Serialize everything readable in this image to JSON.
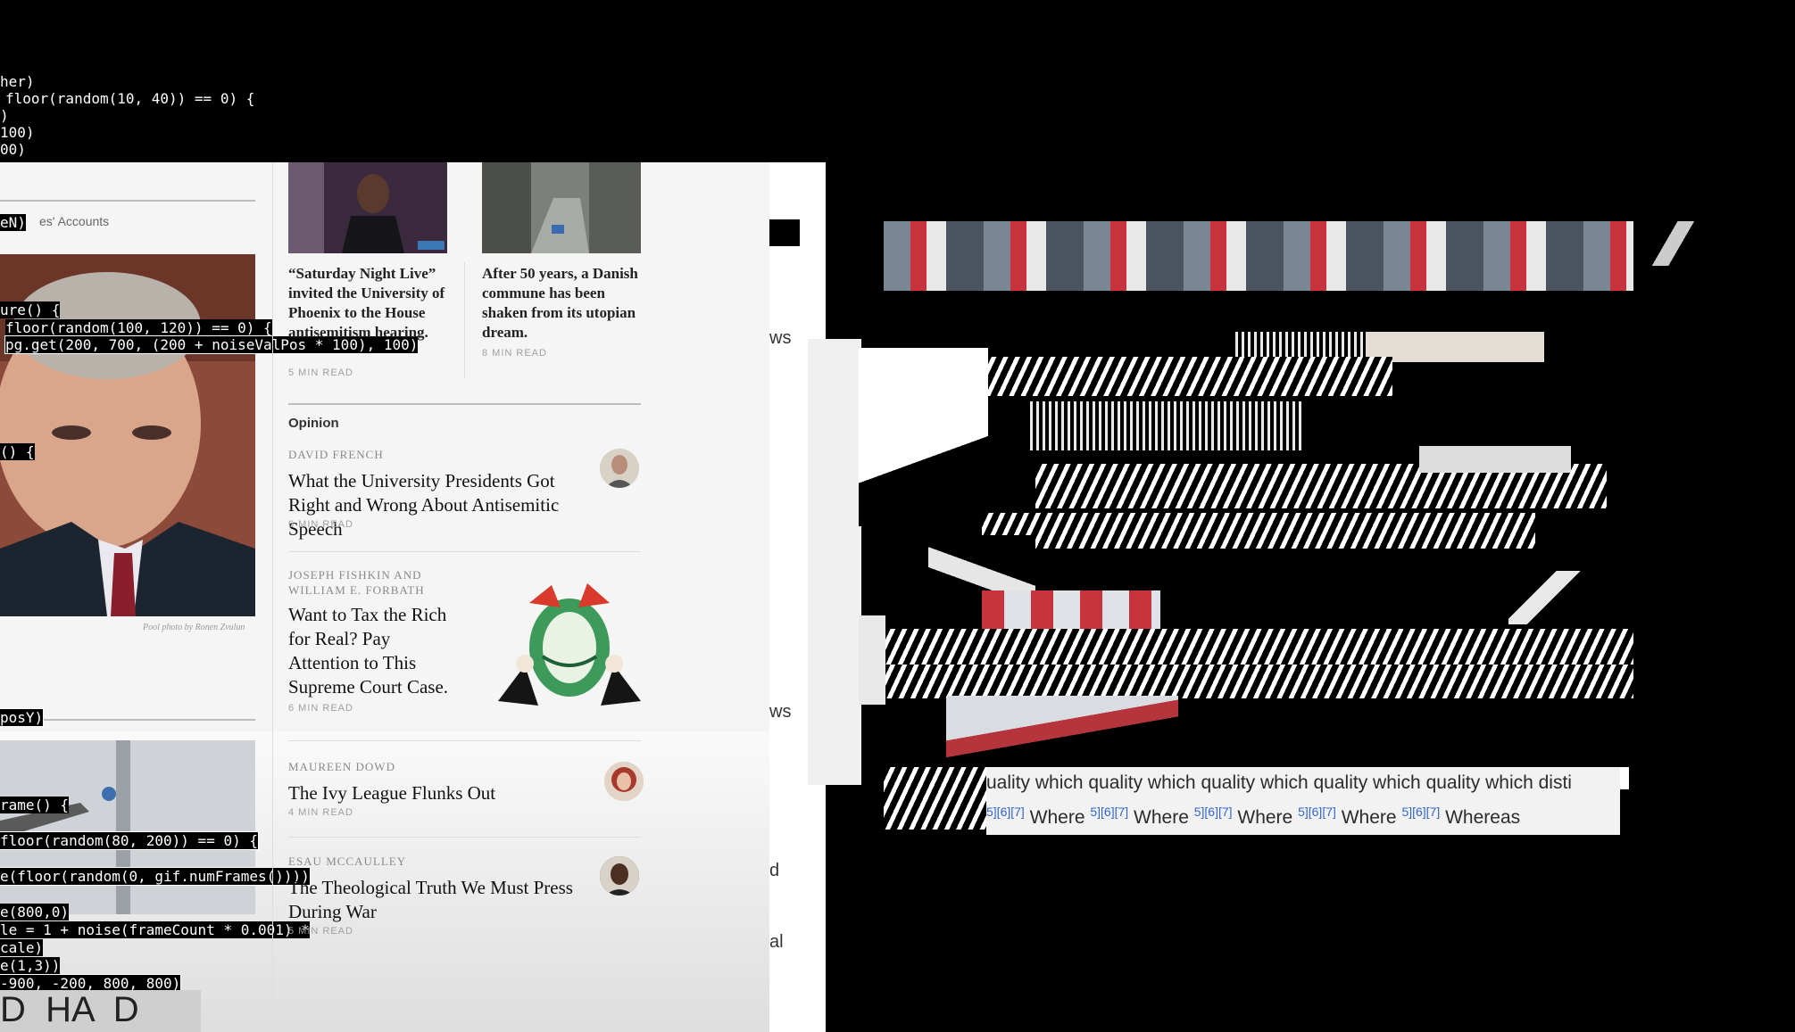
{
  "code_lines": [
    "her)",
    "floor(random(10, 40)) == 0) {",
    ")",
    "100)",
    "00)",
    "ure() {",
    "floor(random(100, 120)) == 0) {",
    "pg.get(200, 700, (200 + noiseValPos * 100), 100)",
    "() {",
    "posY)",
    "rame() {",
    "floor(random(80, 200)) == 0) {",
    "e(floor(random(0, gif.numFrames())))",
    "e(800,0)",
    "le = 1 + noise(frameCount * 0.001) *",
    "cale)",
    "e(1,3))",
    "-900, -200, 800, 800)"
  ],
  "left_column": {
    "accounts_label": "es' Accounts",
    "photo_credit": "Pool photo by Ronen Zvulun",
    "sign_text": "D  HA  D"
  },
  "top_stories": [
    {
      "headline": "“Saturday Night Live” invited the University of Phoenix to the House antisemitism hearing.",
      "read_time": "5 MIN READ"
    },
    {
      "headline": "After 50 years, a Danish commune has been shaken from its utopian dream.",
      "read_time": "8 MIN READ"
    }
  ],
  "opinion": {
    "section_label": "Opinion",
    "items": [
      {
        "author": "DAVID FRENCH",
        "headline": "What the University Presidents Got Right and Wrong About Antisemitic Speech",
        "read_time": "6 MIN READ"
      },
      {
        "author": "JOSEPH FISHKIN AND WILLIAM E. FORBATH",
        "headline": "Want to Tax the Rich for Real? Pay Attention to This Supreme Court Case.",
        "read_time": "6 MIN READ"
      },
      {
        "author": "MAUREEN DOWD",
        "headline": "The Ivy League Flunks Out",
        "read_time": "4 MIN READ"
      },
      {
        "author": "ESAU MCCAULLEY",
        "headline": "The Theological Truth We Must Press During War",
        "read_time": "5 MIN READ"
      }
    ]
  },
  "edge_fragments": [
    "ws",
    "ws",
    "d",
    "al"
  ],
  "wiki_strip": {
    "row1": "uality which quality which quality which quality which quality which disti",
    "refs": "5][6][7]",
    "where": "Where",
    "whereas": "Whereas"
  },
  "colors": {
    "code_green": "#3fe08a",
    "page_bg": "#f5f5f5",
    "link_blue": "#3366cc",
    "tie_red": "#8b1e2b"
  }
}
